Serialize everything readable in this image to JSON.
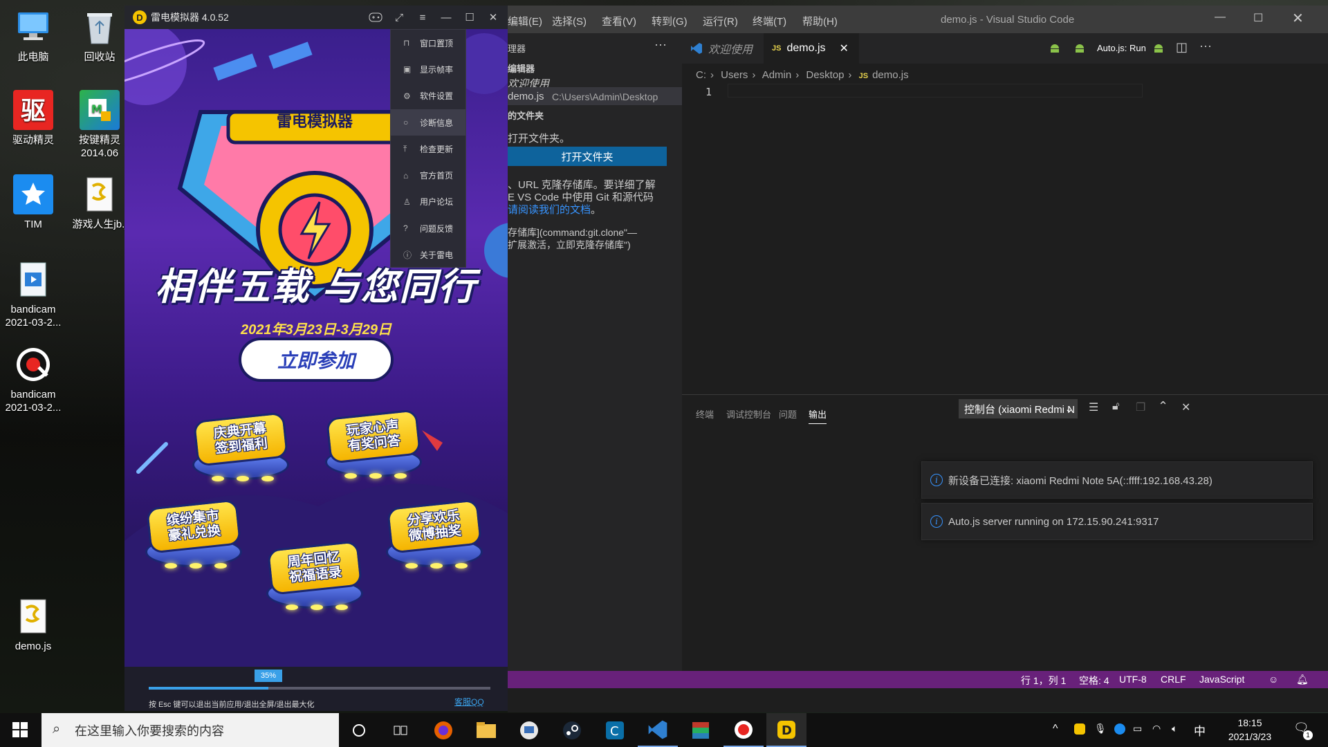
{
  "desktop": {
    "icons": [
      {
        "label": "此电脑",
        "label2": ""
      },
      {
        "label": "回收站",
        "label2": ""
      },
      {
        "label": "驱动精灵",
        "label2": ""
      },
      {
        "label": "按键精灵",
        "label2": "2014.06"
      },
      {
        "label": "TIM",
        "label2": ""
      },
      {
        "label": "游戏人生jb.j",
        "label2": ""
      },
      {
        "label": "bandicam",
        "label2": "2021-03-2..."
      },
      {
        "label": "bandicam",
        "label2": "2021-03-2..."
      },
      {
        "label": "demo.js",
        "label2": ""
      }
    ]
  },
  "emulator": {
    "title": "雷电模拟器 4.0.52",
    "menu": [
      "窗口置顶",
      "显示帧率",
      "软件设置",
      "诊断信息",
      "检查更新",
      "官方首页",
      "用户论坛",
      "问题反馈",
      "关于雷电"
    ],
    "banner": {
      "brand": "雷电模拟器",
      "slogan": "相伴五载 与您同行",
      "dates": "2021年3月23日-3月29日",
      "join_button": "立即参加",
      "pods": [
        {
          "line1": "庆典开幕",
          "line2": "签到福利"
        },
        {
          "line1": "玩家心声",
          "line2": "有奖问答"
        },
        {
          "line1": "缤纷集市",
          "line2": "豪礼兑换"
        },
        {
          "line1": "分享欢乐",
          "line2": "微博抽奖"
        },
        {
          "line1": "周年回忆",
          "line2": "祝福语录"
        }
      ]
    },
    "progress": 0.35,
    "progress_label": "35%",
    "hint": "按 Esc 键可以退出当前应用/退出全屏/退出最大化",
    "support_link": "客服QQ"
  },
  "vscode": {
    "title": "demo.js - Visual Studio Code",
    "menu": [
      "编辑(E)",
      "选择(S)",
      "查看(V)",
      "转到(G)",
      "运行(R)",
      "终端(T)",
      "帮助(H)"
    ],
    "sidebar": {
      "header": "理器",
      "open_editors": "编辑器",
      "editor1": "欢迎使用",
      "editor2_name": "demo.js",
      "editor2_path": "C:\\Users\\Admin\\Desktop",
      "no_folder": "的文件夹",
      "no_folder_msg": "打开文件夹。",
      "open_folder_button": "打开文件夹",
      "git_l1": "、URL 克隆存储库。要详细了解",
      "git_l2": "E VS Code 中使用 Git 和源代码",
      "git_link": "请阅读我们的文档",
      "git_end": "。",
      "clone_l1": "存储库](command:git.clone\"—",
      "clone_l2": "扩展激活，立即克隆存储库\")"
    },
    "tabs": [
      {
        "label": "欢迎使用",
        "icon": "vscode-icon"
      },
      {
        "label": "demo.js",
        "icon": "js-icon"
      }
    ],
    "js_badge": "JS",
    "run_label": "Auto.js: Run",
    "breadcrumb": [
      "C:",
      "Users",
      "Admin",
      "Desktop",
      "demo.js"
    ],
    "line_number": "1",
    "panel": {
      "tabs": [
        "终端",
        "调试控制台",
        "问题",
        "输出"
      ],
      "active_tab": "输出",
      "dropdown": "控制台 (xiaomi Redmi N"
    },
    "notifications": [
      "新设备已连接: xiaomi Redmi Note 5A(::ffff:192.168.43.28)",
      "Auto.js server running on 172.15.90.241:9317"
    ],
    "status": {
      "position": "行 1，列 1",
      "spaces": "空格: 4",
      "encoding": "UTF-8",
      "eol": "CRLF",
      "language": "JavaScript"
    }
  },
  "taskbar": {
    "search_placeholder": "在这里输入你要搜索的内容",
    "ime": "中",
    "time": "18:15",
    "date": "2021/3/23",
    "notifications_count": "1"
  },
  "colors": {
    "statusbar": "#68217a",
    "accent_blue": "#0e639c",
    "emulator_yellow": "#f5c400"
  }
}
